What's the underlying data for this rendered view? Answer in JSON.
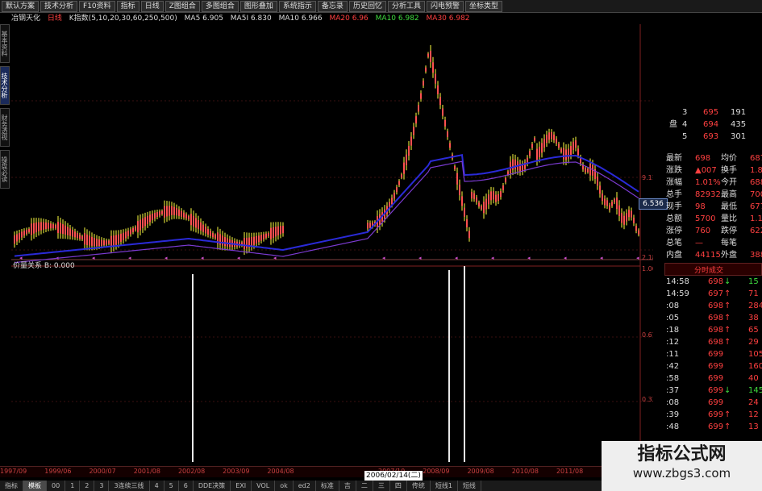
{
  "toolbar": [
    "默认方案",
    "技术分析",
    "F10资料",
    "指标",
    "日线",
    "Z图组合",
    "多图组合",
    "图形叠加",
    "系统指示",
    "备忘录",
    "历史回忆",
    "分析工具",
    "闪电预警",
    "坐标类型"
  ],
  "info": {
    "name": "冶钢天化",
    "period": "日线",
    "indicator": "K指数(5,10,20,30,60,250,500)",
    "ma5": "MA5 6.905",
    "ma5b": "MA5I 6.830",
    "ma10": "MA10 6.966",
    "ma10b": "MA10 6.982",
    "ma20": "MA20 6.96",
    "ma30": "MA30 6.982"
  },
  "left_tabs": [
    "基本资料",
    "技术分析",
    "财务透视",
    "操盘必读"
  ],
  "sub_indicator": "价量关系 B: 0.000",
  "axis_labels": {
    "p1": "9.11",
    "p2": "2.18",
    "p3": "1.00",
    "p4": "0.67",
    "p5": "0.33"
  },
  "price_tag": "6.536",
  "orderbook": [
    {
      "level": "3",
      "price": "695",
      "vol": "191"
    },
    {
      "level": "4",
      "price": "694",
      "vol": "435"
    },
    {
      "level": "5",
      "price": "693",
      "vol": "301"
    }
  ],
  "book_label": "盘",
  "stats": [
    {
      "l1": "最新",
      "v1": "698",
      "l2": "均价",
      "v2": "687"
    },
    {
      "l1": "涨跌",
      "v1": "▲007",
      "l2": "换手",
      "v2": "1.89"
    },
    {
      "l1": "涨幅",
      "v1": "1.01%",
      "l2": "今开",
      "v2": "688"
    },
    {
      "l1": "总手",
      "v1": "82932",
      "l2": "最高",
      "v2": "700"
    },
    {
      "l1": "现手",
      "v1": "98",
      "l2": "最低",
      "v2": "677"
    },
    {
      "l1": "总额",
      "v1": "5700",
      "l2": "量比",
      "v2": "1.11"
    },
    {
      "l1": "涨停",
      "v1": "760",
      "l2": "跌停",
      "v2": "622"
    },
    {
      "l1": "总笔",
      "v1": "—",
      "l2": "每笔",
      "v2": ""
    },
    {
      "l1": "内盘",
      "v1": "44115",
      "l2": "外盘",
      "v2": "38817"
    }
  ],
  "ticks_header": "分时成交",
  "ticks": [
    {
      "t": "14:58",
      "p": "698",
      "a": "↓",
      "v": "15"
    },
    {
      "t": "14:59",
      "p": "697",
      "a": "↑",
      "v": "71"
    },
    {
      "t": ":08",
      "p": "698",
      "a": "↑",
      "v": "284"
    },
    {
      "t": ":05",
      "p": "698",
      "a": "↑",
      "v": "38"
    },
    {
      "t": ":18",
      "p": "698",
      "a": "↑",
      "v": "65"
    },
    {
      "t": ":12",
      "p": "698",
      "a": "↑",
      "v": "29"
    },
    {
      "t": ":11",
      "p": "699",
      "a": "",
      "v": "105"
    },
    {
      "t": ":42",
      "p": "699",
      "a": "",
      "v": "160"
    },
    {
      "t": ":58",
      "p": "699",
      "a": "",
      "v": "40"
    },
    {
      "t": ":37",
      "p": "699",
      "a": "↓",
      "v": "145"
    },
    {
      "t": ":08",
      "p": "699",
      "a": "",
      "v": "24"
    },
    {
      "t": ":39",
      "p": "699",
      "a": "↑",
      "v": "12"
    },
    {
      "t": ":48",
      "p": "699",
      "a": "↑",
      "v": "13"
    }
  ],
  "date_axis": [
    "1997/09",
    "1999/06",
    "2000/07",
    "2001/08",
    "2002/08",
    "2003/09",
    "2004/08",
    "2006/02/14(二)",
    "2007/10",
    "2008/09",
    "2009/08",
    "2010/08",
    "2011/08"
  ],
  "date_selected": "2006/02/14(二)",
  "bottom_tabs": [
    "指标",
    "模板",
    "00",
    "1",
    "2",
    "3",
    "3连续三线",
    "4",
    "5",
    "6",
    "DDE决策",
    "EXI",
    "VOL",
    "ok",
    "ed2",
    "标准",
    "吉",
    "二",
    "三",
    "四",
    "传统",
    "短线1",
    "短线"
  ],
  "watermark": {
    "line1": "指标公式网",
    "line2": "www.zbgs3.com"
  }
}
